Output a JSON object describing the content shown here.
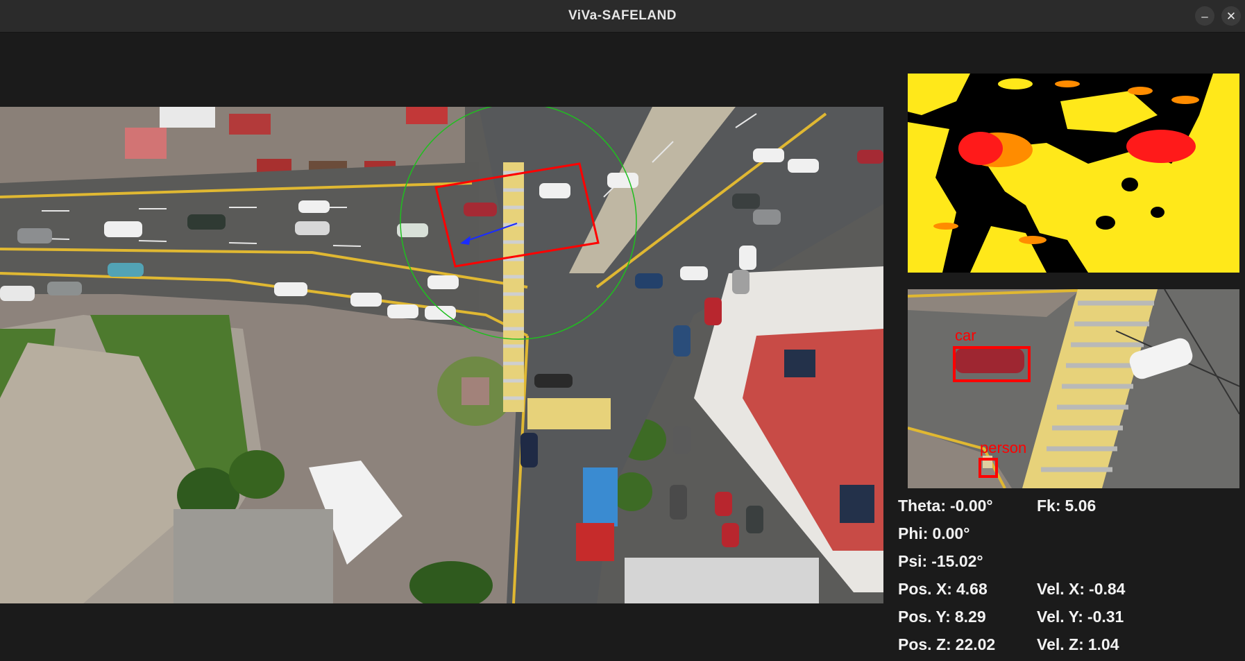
{
  "window": {
    "title": "ViVa-SAFELAND",
    "minimize_glyph": "–",
    "close_glyph": "✕"
  },
  "crop": {
    "detections": [
      {
        "label": "car"
      },
      {
        "label": "person"
      }
    ]
  },
  "telemetry": {
    "theta": {
      "label": "Theta:",
      "value": "-0.00°"
    },
    "phi": {
      "label": "Phi:",
      "value": "0.00°"
    },
    "psi": {
      "label": "Psi:",
      "value": "-15.02°"
    },
    "pos_x": {
      "label": "Pos. X:",
      "value": "4.68"
    },
    "pos_y": {
      "label": "Pos. Y:",
      "value": "8.29"
    },
    "pos_z": {
      "label": "Pos. Z:",
      "value": "22.02"
    },
    "fk": {
      "label": "Fk:",
      "value": "5.06"
    },
    "vel_x": {
      "label": "Vel. X:",
      "value": "-0.84"
    },
    "vel_y": {
      "label": "Vel. Y:",
      "value": "-0.31"
    },
    "vel_z": {
      "label": "Vel. Z:",
      "value": "1.04"
    }
  },
  "colors": {
    "overlay_box": "#ff0000",
    "heading_arrow": "#1a2cff",
    "safe_circle": "#1fbf1f",
    "heat_low": "#ffe81a",
    "heat_mid": "#ff8c00",
    "heat_high": "#ff1a1a"
  }
}
